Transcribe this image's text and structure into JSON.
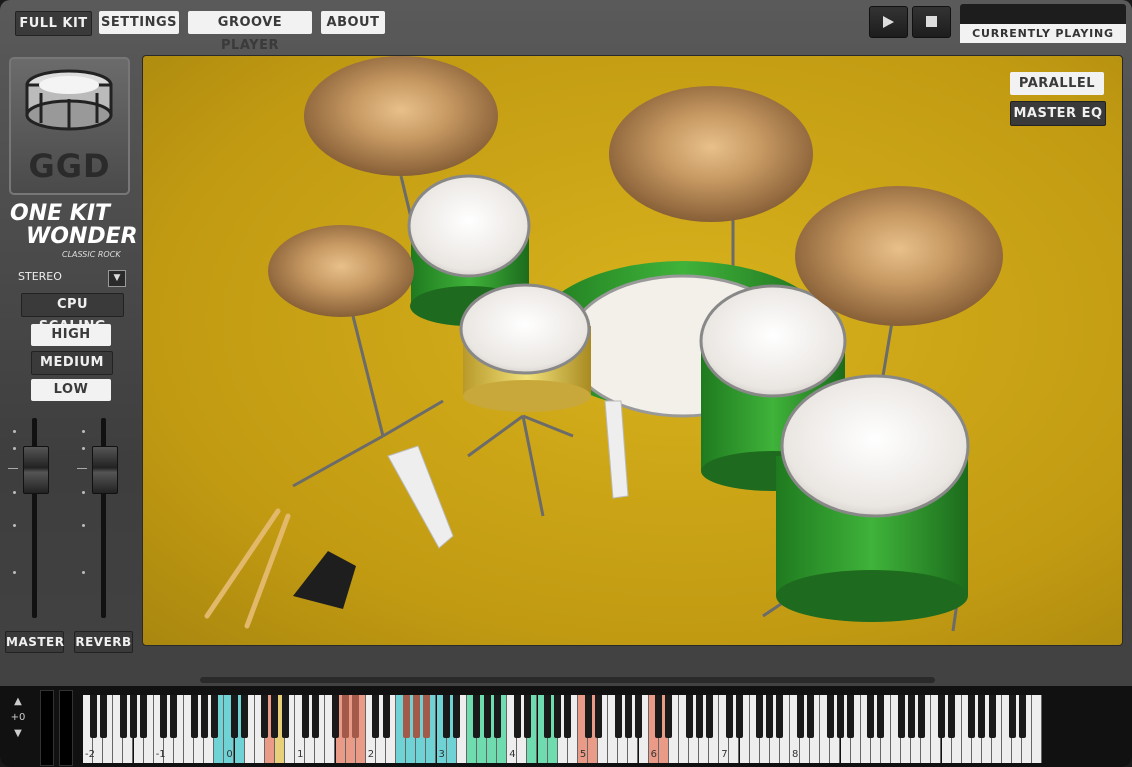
{
  "nav": {
    "tabs": [
      "FULL KIT",
      "SETTINGS",
      "GROOVE PLAYER",
      "ABOUT"
    ],
    "active_tab": "FULL KIT"
  },
  "transport": {
    "play_icon": "play-icon",
    "stop_icon": "stop-icon",
    "now_playing_label": "CURRENTLY PLAYING"
  },
  "brand": {
    "logo_text": "GGD",
    "title_line1": "ONE KIT",
    "title_line2": "WONDER",
    "subtitle": "CLASSIC ROCK"
  },
  "left_panel": {
    "output_mode": "STEREO",
    "cpu_scaling_label": "CPU SCALING",
    "cpu_options": [
      "HIGH",
      "MEDIUM",
      "LOW"
    ],
    "cpu_selected": "MEDIUM",
    "fader_labels": [
      "MASTER",
      "REVERB"
    ]
  },
  "stage": {
    "buttons": [
      "PARALLEL",
      "MASTER EQ"
    ],
    "active_button": "MASTER EQ"
  },
  "keyboard": {
    "octave_shift": "+0",
    "octave_labels": [
      "-2",
      "-1",
      "0",
      "1",
      "2",
      "3",
      "4",
      "5",
      "6",
      "7",
      "8"
    ],
    "colors": {
      "cyan": "#6fd3d6",
      "salmon": "#e99b87",
      "yellow": "#e8cf7a",
      "green": "#6fdcb0",
      "olive": "#b5a84a"
    }
  }
}
